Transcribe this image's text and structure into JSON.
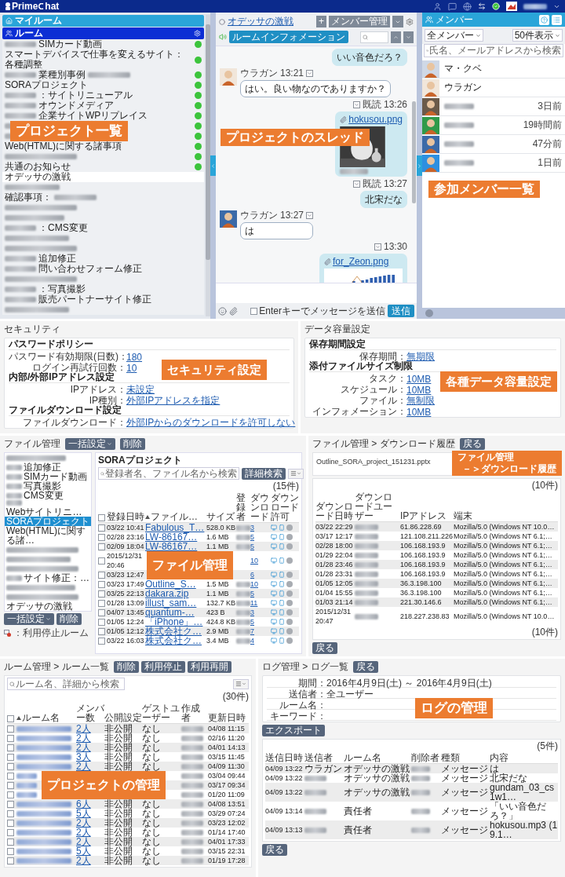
{
  "header": {
    "logo_1": "Prime",
    "logo_2": "hat"
  },
  "sidebar": {
    "my_room": "マイルーム",
    "rooms_title": "ルーム",
    "callout": "プロジェクト一覧",
    "rooms": [
      {
        "text": "SIMカード動画",
        "blurred": false,
        "blurred_before": true,
        "blurred_after": false,
        "active": true,
        "selected": false
      },
      {
        "text": "スマートデバイスで仕事を変えるサイト：各種調整",
        "blurred": false,
        "blurred_before": false,
        "blurred_after": false,
        "active": true,
        "selected": false
      },
      {
        "text": "業種別事例",
        "blurred": false,
        "blurred_before": true,
        "blurred_after": true,
        "active": true,
        "selected": false
      },
      {
        "text": "SORAプロジェクト",
        "blurred": false,
        "blurred_before": false,
        "blurred_after": false,
        "active": true,
        "selected": false
      },
      {
        "text": "：サイトリニューアル",
        "blurred": false,
        "blurred_before": true,
        "blurred_after": false,
        "active": true,
        "selected": false
      },
      {
        "text": "オウンドメディア",
        "blurred": false,
        "blurred_before": true,
        "blurred_after": false,
        "active": true,
        "selected": false
      },
      {
        "text": "企業サイトWPリプレイス",
        "blurred": false,
        "blurred_before": true,
        "blurred_after": false,
        "active": true,
        "selected": false
      },
      {
        "blurred": true,
        "active": true,
        "selected": false
      },
      {
        "blurred": true,
        "active": true,
        "selected": false
      },
      {
        "text": "Web(HTML)に関する諸事項",
        "blurred": false,
        "blurred_before": false,
        "blurred_after": false,
        "active": true,
        "selected": false
      },
      {
        "blurred": true,
        "active": true,
        "selected": false
      },
      {
        "text": "共通のお知らせ",
        "blurred": false,
        "blurred_before": false,
        "blurred_after": false,
        "active": true,
        "selected": false
      },
      {
        "text": "オデッサの激戦",
        "blurred": false,
        "blurred_before": false,
        "blurred_after": false,
        "active": false,
        "selected": true
      },
      {
        "blurred": true,
        "active": false,
        "selected": false
      },
      {
        "text": "確認事項：",
        "blurred": false,
        "blurred_before": false,
        "blurred_after": true,
        "active": false,
        "selected": false
      },
      {
        "blurred": true,
        "active": false,
        "selected": false
      },
      {
        "blurred": true,
        "active": false,
        "selected": false
      },
      {
        "text": "：CMS変更",
        "blurred": false,
        "blurred_before": true,
        "blurred_after": false,
        "active": false,
        "selected": false
      },
      {
        "blurred": true,
        "active": false,
        "selected": false
      },
      {
        "blurred": true,
        "active": false,
        "selected": false
      },
      {
        "text": "追加修正",
        "blurred": false,
        "blurred_before": true,
        "blurred_after": false,
        "active": false,
        "selected": false
      },
      {
        "text": "問い合わせフォーム修正",
        "blurred": false,
        "blurred_before": true,
        "blurred_after": false,
        "active": false,
        "selected": false
      },
      {
        "blurred": true,
        "active": false,
        "selected": false
      },
      {
        "text": "：写真撮影",
        "blurred": false,
        "blurred_before": true,
        "blurred_after": false,
        "active": false,
        "selected": false
      },
      {
        "text": "販売パートナーサイト修正",
        "blurred": false,
        "blurred_before": true,
        "blurred_after": false,
        "active": false,
        "selected": false
      },
      {
        "blurred": true,
        "active": false,
        "selected": false
      }
    ]
  },
  "chat": {
    "room_title": "オデッサの激戦",
    "info_button": "ルームインフォメーション",
    "add_button": "+",
    "members_button": "メンバー管理",
    "callout": "プロジェクトのスレッド",
    "messages": [
      {
        "kind": "text",
        "outgoing": true,
        "text": "いい音色だろ？"
      },
      {
        "kind": "text",
        "outgoing": false,
        "sender": "ウラガン",
        "time": "13:21",
        "text": "はい。良い物なのでありますか？"
      },
      {
        "outgoing": true,
        "read": "既読",
        "time": "13:26",
        "file": "hokusou.png",
        "blurred_caption": true
      },
      {
        "kind": "text",
        "outgoing": true,
        "read": "既読",
        "time": "13:27",
        "text": "北宋だな"
      },
      {
        "kind": "text",
        "outgoing": false,
        "sender": "ウラガン",
        "time": "13:27",
        "text": "は"
      },
      {
        "kind": "chart",
        "outgoing": true,
        "time": "13:30",
        "file": "for_Zeon.png",
        "blurred_caption": false
      }
    ],
    "enter_option": {
      "label": "Enterキーでメッセージを送信",
      "checked": false
    },
    "send_button": "送信"
  },
  "members": {
    "title": "メンバー",
    "filter": "全メンバー",
    "page_size": "50件表示",
    "search_placeholder": "氏名、メールアドレスから検索",
    "callout": "参加メンバー一覧",
    "items": [
      {
        "name": "マ・クベ",
        "blurred": false
      },
      {
        "name": "ウラガン",
        "blurred": false
      },
      {
        "blurred": true,
        "last_seen": "3日前"
      },
      {
        "blurred": true,
        "last_seen": "19時間前"
      },
      {
        "blurred": true,
        "last_seen": "47分前"
      },
      {
        "blurred": true,
        "last_seen": "1日前"
      }
    ]
  },
  "security": {
    "title": "セキュリティ",
    "callout": "セキュリティ設定",
    "groups": [
      {
        "title": "パスワードポリシー",
        "rows": [
          {
            "label": "パスワード有効期限(日数)：",
            "value": "180"
          },
          {
            "label": "ログイン再試行回数：",
            "value": "10"
          }
        ]
      },
      {
        "title": "内部/外部IPアドレス設定",
        "rows": [
          {
            "label": "IPアドレス：",
            "value": "未設定"
          },
          {
            "label": "IP種別：",
            "value": "外部IPアドレスを指定"
          }
        ]
      },
      {
        "title": "ファイルダウンロード設定",
        "rows": [
          {
            "label": "ファイルダウンロード：",
            "value": "外部IPからのダウンロードを許可しない"
          }
        ]
      }
    ]
  },
  "data_capacity": {
    "title": "データ容量設定",
    "callout": "各種データ容量設定",
    "groups": [
      {
        "title": "保存期間設定",
        "rows": [
          {
            "label": "保存期間：",
            "value": "無期限"
          }
        ]
      },
      {
        "title": "添付ファイルサイズ制限",
        "rows": [
          {
            "label": "タスク：",
            "value": "10MB"
          },
          {
            "label": "スケジュール：",
            "value": "10MB"
          },
          {
            "label": "ファイル：",
            "value": "無制限"
          },
          {
            "label": "インフォメーション：",
            "value": "10MB"
          }
        ]
      }
    ]
  },
  "file_management": {
    "title": "ファイル管理",
    "bulk_button": "一括設定",
    "delete_button": "削除",
    "bottom_bulk_button": "一括設定",
    "bottom_delete_button": "削除",
    "legend": "：利用停止ルーム",
    "callout": "ファイル管理",
    "rooms": [
      {
        "blurred": true,
        "selected": false
      },
      {
        "text": "追加修正",
        "blurred": false,
        "blurred_before": true,
        "blurred_after": false,
        "selected": false
      },
      {
        "text": "SIMカード動画",
        "blurred": false,
        "blurred_before": true,
        "blurred_after": false,
        "selected": false
      },
      {
        "text": "写真撮影",
        "blurred": false,
        "blurred_before": true,
        "blurred_after": false,
        "selected": false
      },
      {
        "text": "CMS変更",
        "blurred": false,
        "blurred_before": true,
        "blurred_after": false,
        "selected": false
      },
      {
        "text": "Webサイトリニ…",
        "blurred": false,
        "blurred_before": true,
        "blurred_after": false,
        "selected": false
      },
      {
        "text": "SORAプロジェクト",
        "blurred": false,
        "blurred_before": false,
        "blurred_after": false,
        "selected": true
      },
      {
        "text": "Web(HTML)に関する諸…",
        "blurred": false,
        "blurred_before": false,
        "blurred_after": false,
        "selected": false
      },
      {
        "blurred": true,
        "selected": false
      },
      {
        "blurred": true,
        "selected": false
      },
      {
        "blurred": true,
        "selected": false
      },
      {
        "text": "サイト修正：…",
        "blurred": false,
        "blurred_before": true,
        "blurred_after": false,
        "selected": false
      },
      {
        "blurred": true,
        "selected": false
      },
      {
        "blurred": true,
        "selected": false
      },
      {
        "text": "オデッサの激戦",
        "blurred": false,
        "blurred_before": false,
        "blurred_after": false,
        "selected": false
      }
    ],
    "room_title": "SORAプロジェクト",
    "search_placeholder": "登録者名、ファイル名から検索",
    "advanced_search": "詳細検索",
    "count": "(15件)",
    "all_checked": false,
    "columns": [
      {
        "label": "登録日時",
        "kind": "text"
      },
      {
        "label": "ファイル…",
        "kind": "link",
        "sorted": true
      },
      {
        "label": "サイズ",
        "kind": "text"
      },
      {
        "label": "登録者",
        "kind": "text"
      },
      {
        "label": "ダウンロード",
        "kind": "link"
      },
      {
        "label": "ダウンロード許可",
        "kind": "icons"
      }
    ],
    "rows": [
      {
        "checked": false,
        "cells": [
          "03/22 10:41",
          "Fabulous_T…",
          "528.0 KB",
          {
            "blurred": true
          },
          "3"
        ]
      },
      {
        "checked": false,
        "cells": [
          "02/28 23:16",
          "LW-86167…",
          "1.6 MB",
          {
            "blurred": true
          },
          "5"
        ]
      },
      {
        "checked": false,
        "cells": [
          "02/09 18:04",
          "LW-86167…",
          "1.1 MB",
          {
            "blurred": true
          },
          "5"
        ]
      },
      {
        "checked": false,
        "covered": true,
        "cells": [
          "2015/12/31 20:46",
          "10"
        ]
      },
      {
        "checked": false,
        "covered": true,
        "cells": [
          "03/23 12:47",
          "6"
        ]
      },
      {
        "checked": false,
        "cells": [
          "03/23 17:49",
          "Outline_S…",
          "1.5 MB",
          {
            "blurred": true
          },
          "10"
        ]
      },
      {
        "checked": false,
        "cells": [
          "03/25 22:13",
          "dakara.zip",
          "1.1 MB",
          {
            "blurred": true
          },
          "5"
        ]
      },
      {
        "checked": false,
        "cells": [
          "01/28 13:09",
          "illust_sam…",
          "132.7 KB",
          {
            "blurred": true
          },
          "11"
        ]
      },
      {
        "checked": false,
        "cells": [
          "04/07 13:45",
          "quantum-…",
          "423 B",
          {
            "blurred": true
          },
          "3"
        ]
      },
      {
        "checked": false,
        "cells": [
          "01/05 12:24",
          "「iPhone」…",
          "424.8 KB",
          {
            "blurred": true
          },
          "5"
        ]
      },
      {
        "checked": false,
        "cells": [
          "01/05 12:12",
          "株式会社ク…",
          "2.9 MB",
          {
            "blurred": true
          },
          "7"
        ]
      },
      {
        "checked": false,
        "cells": [
          "03/22 16:03",
          "株式会社ク…",
          "3.4 MB",
          {
            "blurred": true
          },
          "4"
        ]
      }
    ]
  },
  "download_history": {
    "title": "ファイル管理 > ダウンロード履歴",
    "back_button": "戻る",
    "file": "Outline_SORA_project_151231.pptx",
    "count": "(10件)",
    "callout": [
      "ファイル管理",
      "－＞ダウンロード履歴"
    ],
    "columns": [
      {
        "label": "ダウンロード日時",
        "kind": "text"
      },
      {
        "label": "ダウンロードユーザー",
        "kind": "text"
      },
      {
        "label": "IPアドレス",
        "kind": "text"
      },
      {
        "label": "端末",
        "kind": "text"
      }
    ],
    "rows": [
      {
        "cells": [
          "03/22 22:29",
          {
            "blurred": true
          },
          "61.86.228.69",
          "Mozilla/5.0 (Windows NT 10.0…"
        ]
      },
      {
        "cells": [
          "03/17 12:17",
          {
            "blurred": true
          },
          "121.108.211.226",
          "Mozilla/5.0 (Windows NT 6.1;…"
        ]
      },
      {
        "cells": [
          "02/28 18:00",
          {
            "blurred": true
          },
          "106.168.193.9",
          "Mozilla/5.0 (Windows NT 6.1;…"
        ]
      },
      {
        "cells": [
          "01/29 22:04",
          {
            "blurred": true
          },
          "106.168.193.9",
          "Mozilla/5.0 (Windows NT 6.1;…"
        ]
      },
      {
        "cells": [
          "01/28 23:46",
          {
            "blurred": true
          },
          "106.168.193.9",
          "Mozilla/5.0 (Windows NT 6.1;…"
        ]
      },
      {
        "cells": [
          "01/28 23:31",
          {
            "blurred": true
          },
          "106.168.193.9",
          "Mozilla/5.0 (Windows NT 6.1;…"
        ]
      },
      {
        "cells": [
          "01/05 12:05",
          {
            "blurred": true
          },
          "36.3.198.100",
          "Mozilla/5.0 (Windows NT 6.1;…"
        ]
      },
      {
        "cells": [
          "01/04 15:55",
          {
            "blurred": true
          },
          "36.3.198.100",
          "Mozilla/5.0 (Windows NT 6.1;…"
        ]
      },
      {
        "cells": [
          "01/03 21:14",
          {
            "blurred": true
          },
          "221.30.146.6",
          "Mozilla/5.0 (Windows NT 6.1;…"
        ]
      },
      {
        "cells": [
          "2015/12/31 20:47",
          {
            "blurred": true
          },
          "218.227.238.83",
          "Mozilla/5.0 (Windows NT 10.0…"
        ]
      }
    ],
    "bottom_count": "(10件)",
    "bottom_back_button": "戻る"
  },
  "room_list": {
    "title": "ルーム管理 > ルーム一覧",
    "buttons": [
      "削除",
      "利用停止",
      "利用再開"
    ],
    "search_placeholder": "ルーム名、詳細から検索",
    "count": "(30件)",
    "callout": "プロジェクトの管理",
    "all_checked": false,
    "columns": [
      {
        "label": "ルーム名",
        "kind": "link",
        "sorted": true
      },
      {
        "label": "メンバー数",
        "kind": "link"
      },
      {
        "label": "公開設定",
        "kind": "text"
      },
      {
        "label": "ゲストユーザー",
        "kind": "text"
      },
      {
        "label": "作成者",
        "kind": "text"
      },
      {
        "label": "更新日時",
        "kind": "text"
      }
    ],
    "rows": [
      {
        "checked": false,
        "cells": [
          {
            "blurred": true
          },
          "2人",
          "非公開",
          "なし",
          {
            "blurred": true
          },
          "04/08 11:15"
        ]
      },
      {
        "checked": false,
        "cells": [
          {
            "blurred": true
          },
          "2人",
          "非公開",
          "なし",
          {
            "blurred": true
          },
          "02/16 11:20"
        ]
      },
      {
        "checked": false,
        "cells": [
          {
            "blurred": true
          },
          "2人",
          "非公開",
          "なし",
          {
            "blurred": true
          },
          "04/01 14:13"
        ]
      },
      {
        "checked": false,
        "cells": [
          {
            "blurred": true
          },
          "3人",
          "非公開",
          "なし",
          {
            "blurred": true
          },
          "03/15 11:45"
        ]
      },
      {
        "checked": false,
        "cells": [
          {
            "blurred": true
          },
          "2人",
          "非公開",
          "なし",
          {
            "blurred": true
          },
          "04/09 11:30"
        ]
      },
      {
        "checked": false,
        "covered": true,
        "cells": [
          {
            "blurred": true
          },
          {
            "blurred": true
          },
          "03/04 09:44"
        ]
      },
      {
        "checked": false,
        "covered": true,
        "cells": [
          {
            "blurred": true
          },
          {
            "blurred": true
          },
          "03/17 09:34"
        ]
      },
      {
        "checked": false,
        "covered": true,
        "cells": [
          {
            "blurred": true
          },
          {
            "blurred": true
          },
          "01/20 11:09"
        ]
      },
      {
        "checked": false,
        "cells": [
          {
            "blurred": true
          },
          "6人",
          "非公開",
          "なし",
          {
            "blurred": true
          },
          "04/08 13:51"
        ]
      },
      {
        "checked": false,
        "cells": [
          {
            "blurred": true
          },
          "5人",
          "非公開",
          "なし",
          {
            "blurred": true
          },
          "03/29 07:24"
        ]
      },
      {
        "checked": false,
        "cells": [
          {
            "blurred": true
          },
          "2人",
          "非公開",
          "なし",
          {
            "blurred": true
          },
          "03/23 12:02"
        ]
      },
      {
        "checked": false,
        "cells": [
          {
            "blurred": true
          },
          "2人",
          "非公開",
          "なし",
          {
            "blurred": true
          },
          "01/14 17:40"
        ]
      },
      {
        "checked": false,
        "cells": [
          {
            "blurred": true
          },
          "2人",
          "非公開",
          "なし",
          {
            "blurred": true
          },
          "04/01 17:33"
        ]
      },
      {
        "checked": false,
        "cells": [
          {
            "blurred": true
          },
          "5人",
          "非公開",
          "なし",
          {
            "blurred": true
          },
          "03/15 22:31"
        ]
      },
      {
        "checked": false,
        "cells": [
          {
            "blurred": true
          },
          "2人",
          "非公開",
          "なし",
          {
            "blurred": true
          },
          "01/19 17:28"
        ]
      }
    ]
  },
  "log": {
    "title": "ログ管理 > ログ一覧",
    "back_button": "戻る",
    "callout": "ログの管理",
    "filters": [
      {
        "label": "期間：",
        "value": "2016年4月9日(土) ～ 2016年4月9日(土)"
      },
      {
        "label": "送信者：",
        "value": "全ユーザー"
      },
      {
        "label": "ルーム名："
      },
      {
        "label": "キーワード："
      }
    ],
    "export_button": "エクスポート",
    "count": "(5件)",
    "columns": [
      {
        "label": "送信日時",
        "kind": "text"
      },
      {
        "label": "送信者",
        "kind": "text"
      },
      {
        "label": "ルーム名",
        "kind": "text"
      },
      {
        "label": "削除者",
        "kind": "text"
      },
      {
        "label": "種類",
        "kind": "text"
      },
      {
        "label": "内容",
        "kind": "text"
      }
    ],
    "rows": [
      {
        "cells": [
          "04/09 13:22",
          "ウラガン",
          "オデッサの激戦",
          {
            "blurred": true
          },
          "メッセージ",
          "は"
        ]
      },
      {
        "cells": [
          "04/09 13:22",
          {
            "blurred": true
          },
          "オデッサの激戦",
          {
            "blurred": true
          },
          "メッセージ",
          "北宋だな"
        ]
      },
      {
        "cells": [
          "04/09 13:22",
          {
            "blurred": true
          },
          "オデッサの激戦",
          {
            "blurred": true
          },
          "メッセージ",
          "gundam_03_cs1w1…"
        ]
      },
      {
        "cells": [
          "04/09 13:14",
          {
            "blurred": true
          },
          "責任者",
          {
            "blurred": true
          },
          "メッセージ",
          "「いい音色だろ？」"
        ]
      },
      {
        "cells": [
          "04/09 13:13",
          {
            "blurred": true
          },
          "責任者",
          {
            "blurred": true
          },
          "メッセージ",
          "hokusou.mp3 (19.1…"
        ]
      }
    ],
    "bottom_back_button": "戻る"
  }
}
